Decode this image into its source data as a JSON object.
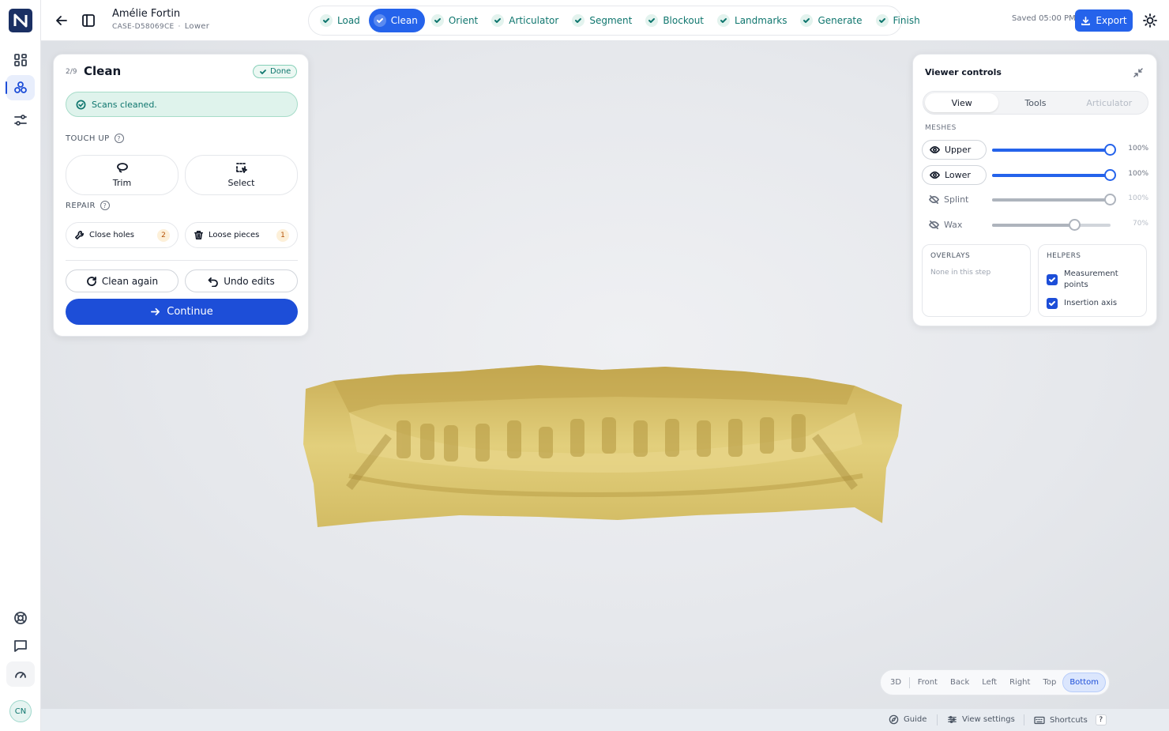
{
  "patient": {
    "name": "Amélie Fortin",
    "case_id": "CASE-D58069CE",
    "arch": "Lower"
  },
  "steps": [
    {
      "label": "Load",
      "state": "done"
    },
    {
      "label": "Clean",
      "state": "active"
    },
    {
      "label": "Orient",
      "state": "done"
    },
    {
      "label": "Articulator",
      "state": "done"
    },
    {
      "label": "Segment",
      "state": "done"
    },
    {
      "label": "Blockout",
      "state": "done"
    },
    {
      "label": "Landmarks",
      "state": "done"
    },
    {
      "label": "Generate",
      "state": "done"
    },
    {
      "label": "Finish",
      "state": "done"
    }
  ],
  "topbar": {
    "saved": "Saved 05:00 PM",
    "export_label": "Export"
  },
  "rail": {
    "avatar": "CN",
    "icons": [
      "grid-icon",
      "molecule-icon",
      "sliders-icon",
      "lifebuoy-icon",
      "chat-icon",
      "gauge-icon"
    ]
  },
  "panel": {
    "step_number": "2/9",
    "title": "Clean",
    "status": "Done",
    "alert": "Scans cleaned.",
    "touch_up_label": "TOUCH UP",
    "touch_up_help": "?",
    "tools": {
      "trim": "Trim",
      "select": "Select"
    },
    "repair_label": "REPAIR",
    "repair_help": "?",
    "repair": {
      "close_holes": {
        "label": "Close holes",
        "count": "2"
      },
      "loose_pieces": {
        "label": "Loose pieces",
        "count": "1"
      }
    },
    "clean_again": "Clean again",
    "undo_edits": "Undo edits",
    "continue": "Continue"
  },
  "viewer": {
    "title": "Viewer controls",
    "tabs": [
      {
        "label": "View",
        "state": "active"
      },
      {
        "label": "Tools",
        "state": "normal"
      },
      {
        "label": "Articulator",
        "state": "disabled"
      }
    ],
    "meshes_label": "MESHES",
    "meshes": [
      {
        "name": "Upper",
        "visible": true,
        "opacity": 100,
        "pct_label": "100%"
      },
      {
        "name": "Lower",
        "visible": true,
        "opacity": 100,
        "pct_label": "100%"
      },
      {
        "name": "Splint",
        "visible": false,
        "opacity": 100,
        "pct_label": "100%"
      },
      {
        "name": "Wax",
        "visible": false,
        "opacity": 70,
        "pct_label": "70%"
      }
    ],
    "overlays_label": "OVERLAYS",
    "overlays_empty": "None in this step",
    "helpers_label": "HELPERS",
    "helpers": {
      "measurement_line1": "Measurement",
      "measurement_line2": "points",
      "insertion_axis": "Insertion axis"
    }
  },
  "view_buttons": [
    {
      "label": "3D",
      "active": false
    },
    {
      "label": "Front",
      "active": false
    },
    {
      "label": "Back",
      "active": false
    },
    {
      "label": "Left",
      "active": false
    },
    {
      "label": "Right",
      "active": false
    },
    {
      "label": "Top",
      "active": false
    },
    {
      "label": "Bottom",
      "active": true
    }
  ],
  "bottom_bar": {
    "guide": "Guide",
    "view_settings": "View settings",
    "shortcuts": "Shortcuts",
    "shortcuts_key": "?"
  },
  "colors": {
    "accent": "#2563eb",
    "success": "#0f766e",
    "model": "#d9c46a"
  }
}
